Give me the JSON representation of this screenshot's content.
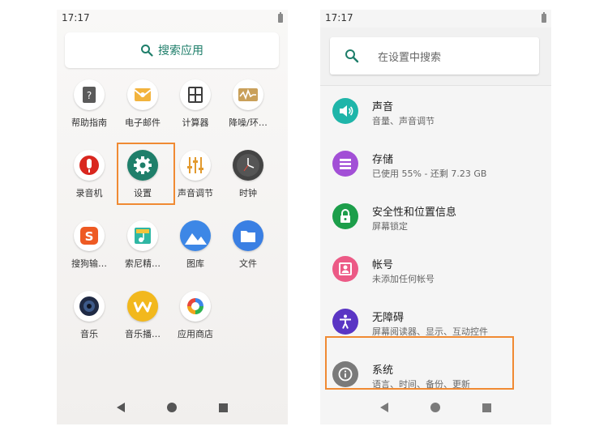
{
  "left_phone": {
    "status_time": "17:17",
    "search_label": "搜索应用",
    "apps": [
      {
        "label": "帮助指南",
        "icon": "help-guide-icon"
      },
      {
        "label": "电子邮件",
        "icon": "email-icon"
      },
      {
        "label": "计算器",
        "icon": "calculator-icon"
      },
      {
        "label": "降噪/环…",
        "icon": "noise-cancel-icon"
      },
      {
        "label": "录音机",
        "icon": "recorder-icon"
      },
      {
        "label": "设置",
        "icon": "settings-gear-icon"
      },
      {
        "label": "声音调节",
        "icon": "sound-adjust-icon"
      },
      {
        "label": "时钟",
        "icon": "clock-icon"
      },
      {
        "label": "搜狗输…",
        "icon": "sogou-input-icon"
      },
      {
        "label": "索尼精…",
        "icon": "sony-select-icon"
      },
      {
        "label": "图库",
        "icon": "gallery-icon"
      },
      {
        "label": "文件",
        "icon": "files-icon"
      },
      {
        "label": "音乐",
        "icon": "music-icon"
      },
      {
        "label": "音乐播…",
        "icon": "walkman-icon"
      },
      {
        "label": "应用商店",
        "icon": "app-store-icon"
      }
    ],
    "highlight_color": "#f08a33"
  },
  "right_phone": {
    "status_time": "17:17",
    "search_placeholder": "在设置中搜索",
    "rows": [
      {
        "title": "声音",
        "subtitle": "音量、声音调节",
        "icon": "volume-icon",
        "color": "#1fb5a9"
      },
      {
        "title": "存储",
        "subtitle": "已使用 55% - 还剩 7.23 GB",
        "icon": "storage-icon",
        "color": "#a24fd6"
      },
      {
        "title": "安全性和位置信息",
        "subtitle": "屏幕锁定",
        "icon": "lock-icon",
        "color": "#1c9e4a"
      },
      {
        "title": "帐号",
        "subtitle": "未添加任何帐号",
        "icon": "account-icon",
        "color": "#ec5a86"
      },
      {
        "title": "无障碍",
        "subtitle": "屏幕阅读器、显示、互动控件",
        "icon": "accessibility-icon",
        "color": "#5a35c4"
      },
      {
        "title": "系统",
        "subtitle": "语言、时间、备份、更新",
        "icon": "info-icon",
        "color": "#7a7a7a"
      }
    ],
    "highlight_color": "#f08a33"
  }
}
